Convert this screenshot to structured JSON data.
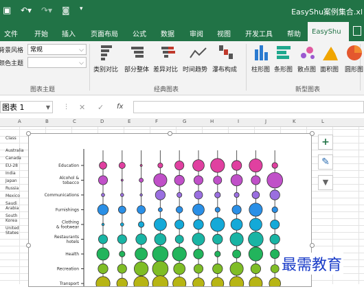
{
  "window": {
    "title": "EasyShu案例集合.xl"
  },
  "quick_access": {
    "undo_icon": "undo-icon",
    "redo_icon": "redo-icon",
    "camera_icon": "camera-icon",
    "more_icon": "chevron-down-icon"
  },
  "tabs": [
    "文件",
    "开始",
    "插入",
    "页面布局",
    "公式",
    "数据",
    "审阅",
    "视图",
    "开发工具",
    "帮助",
    "EasyShu"
  ],
  "active_tab": "EasyShu",
  "ribbon": {
    "theme": {
      "bg_style_label": "背景风格",
      "bg_style_value": "常规",
      "color_theme_label": "颜色主题",
      "color_theme_value": "",
      "group_label": "图表主题"
    },
    "classic": {
      "buttons": [
        "类别对比",
        "部分整体",
        "差异对比",
        "时间趋势",
        "瀑布构成"
      ],
      "group_label": "经典图表"
    },
    "new": {
      "buttons": [
        "柱形图",
        "条形图",
        "散点图",
        "面积图",
        "圆形图"
      ],
      "group_label": "新型图表"
    }
  },
  "formula_bar": {
    "name_box": "图表 1",
    "cancel": "✕",
    "confirm": "✓",
    "fx": "fx"
  },
  "columns": [
    "A",
    "B",
    "C",
    "D",
    "E",
    "F",
    "G",
    "H",
    "I",
    "J",
    "K",
    "L"
  ],
  "class_list": [
    "Class",
    "Australia",
    "Canada",
    "EU-28",
    "India",
    "Japan",
    "Russia",
    "Mexico",
    "Saudi",
    "Arabia",
    "South",
    "Korea",
    "United",
    "States"
  ],
  "side_buttons": [
    "+",
    "✎",
    "▼"
  ],
  "watermark": "最需教育",
  "chart_data": {
    "type": "scatter",
    "categories": [
      "Education",
      "Alcohol & tobacco",
      "Communications",
      "Furnishings",
      "Clothing & footwear",
      "Restaurants hotels",
      "Health",
      "Recreation",
      "Transport"
    ],
    "colors": [
      "#e040a0",
      "#c050c8",
      "#9a6fe0",
      "#2a8fe6",
      "#14a9d8",
      "#19b4a4",
      "#22b45c",
      "#7fbd26",
      "#b7b514"
    ],
    "series_count": 10,
    "sizes": [
      [
        0.45,
        0.38,
        0.12,
        0.3,
        0.55,
        0.7,
        0.85,
        0.6,
        0.8,
        0.35
      ],
      [
        0.55,
        0.1,
        0.25,
        0.8,
        0.6,
        0.55,
        0.5,
        0.7,
        0.55,
        0.95
      ],
      [
        0.2,
        0.2,
        0.15,
        0.6,
        0.3,
        0.5,
        0.35,
        0.3,
        0.45,
        0.6
      ],
      [
        0.65,
        0.45,
        0.5,
        0.25,
        0.4,
        0.7,
        0.3,
        0.55,
        0.8,
        0.35
      ],
      [
        0.15,
        0.2,
        0.35,
        0.75,
        0.55,
        0.6,
        0.85,
        0.7,
        0.75,
        0.55
      ],
      [
        0.55,
        0.55,
        0.65,
        0.7,
        0.5,
        0.75,
        0.6,
        0.8,
        0.9,
        0.6
      ],
      [
        0.75,
        0.35,
        0.75,
        0.95,
        0.85,
        0.6,
        0.35,
        0.5,
        0.85,
        0.55
      ],
      [
        0.6,
        0.55,
        0.85,
        0.95,
        0.7,
        0.55,
        0.6,
        0.8,
        0.6,
        0.5
      ],
      [
        0.85,
        0.65,
        0.9,
        0.95,
        0.8,
        0.7,
        0.75,
        0.85,
        0.8,
        0.7
      ]
    ]
  }
}
